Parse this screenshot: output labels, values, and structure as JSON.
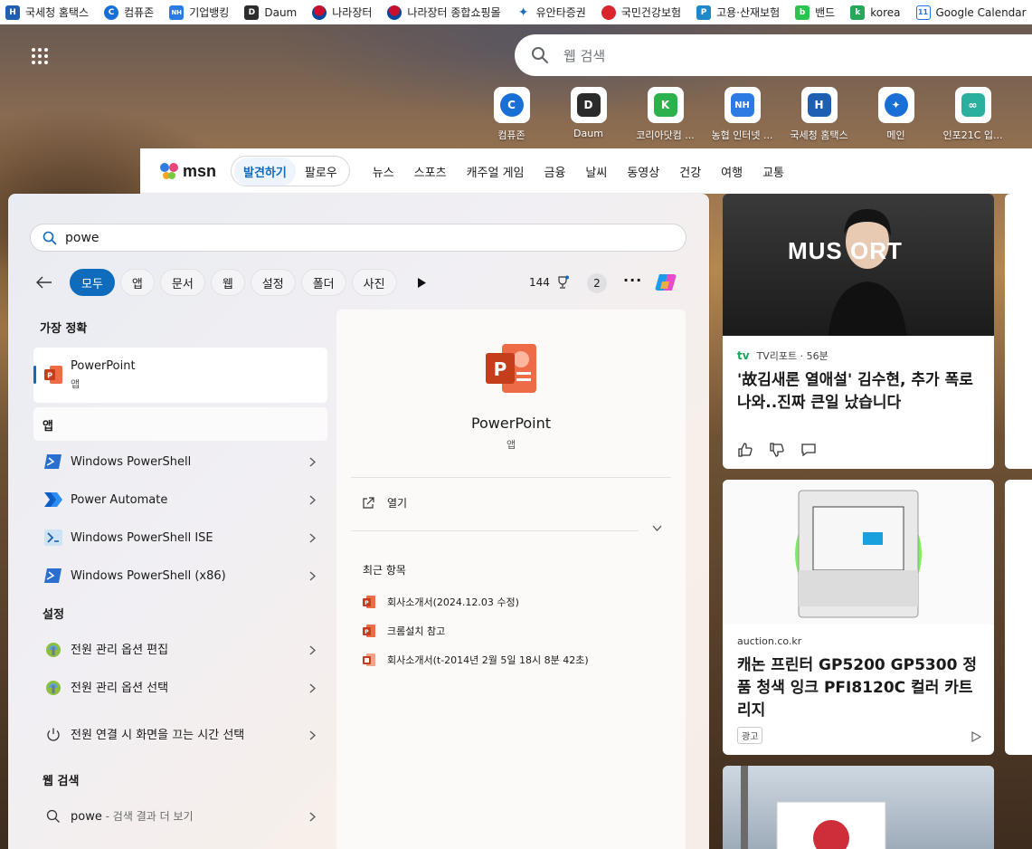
{
  "bookmarks": [
    {
      "label": "국세청 홈택스",
      "color": "#1e5fb4",
      "glyph": "H"
    },
    {
      "label": "컴퓨존",
      "color": "#1a6fd6",
      "glyph": "C"
    },
    {
      "label": "기업뱅킹",
      "color": "#2c7be5",
      "glyph": "NH"
    },
    {
      "label": "Daum",
      "color": "#2b2b2b",
      "glyph": "D"
    },
    {
      "label": "나라장터",
      "color": "#c8102e",
      "glyph": "●"
    },
    {
      "label": "나라장터 종합쇼핑몰",
      "color": "#c8102e",
      "glyph": "●"
    },
    {
      "label": "유안타증권",
      "color": "#1f6fb8",
      "glyph": "✦"
    },
    {
      "label": "국민건강보험",
      "color": "#d9262c",
      "glyph": "●"
    },
    {
      "label": "고용·산재보험",
      "color": "#1e88c9",
      "glyph": "P"
    },
    {
      "label": "밴드",
      "color": "#2bc44d",
      "glyph": "b"
    },
    {
      "label": "korea",
      "color": "#25a85b",
      "glyph": "k"
    },
    {
      "label": "Google Calendar",
      "color": "#1a73e8",
      "glyph": "11"
    }
  ],
  "newtab": {
    "search_placeholder": "웹 검색",
    "tiles": [
      {
        "label": "컴퓨존",
        "color": "#1a6fd6",
        "glyph": "C"
      },
      {
        "label": "Daum",
        "color": "#2b2b2b",
        "glyph": "D"
      },
      {
        "label": "코리아닷컴 ...",
        "color": "#2bb24c",
        "glyph": "K"
      },
      {
        "label": "농협 인터넷 ...",
        "color": "#2c7be5",
        "glyph": "NH"
      },
      {
        "label": "국세청 홈택스",
        "color": "#1e5fb4",
        "glyph": "H"
      },
      {
        "label": "메인",
        "color": "#1a6fd6",
        "glyph": "✦"
      },
      {
        "label": "인포21C 입...",
        "color": "#2bb0a0",
        "glyph": "∞"
      }
    ]
  },
  "msn": {
    "logo": "msn",
    "pill": [
      "발견하기",
      "팔로우"
    ],
    "tabs": [
      "뉴스",
      "스포츠",
      "캐주얼 게임",
      "금융",
      "날씨",
      "동영상",
      "건강",
      "여행",
      "교통"
    ]
  },
  "news": [
    {
      "source": "TV리포트 · 56분",
      "title": "'故김새론 열애설' 김수현, 추가 폭로 나와..진짜 큰일 났습니다",
      "image_text": "MUS  ORT"
    },
    {
      "source": "auction.co.kr",
      "title": "캐논 프린터 GP5200 GP5300 정품 청색 잉크 PFI8120C 컬러 카트리지",
      "badge": "광고"
    }
  ],
  "search": {
    "query": "powe",
    "filters": [
      "모두",
      "앱",
      "문서",
      "웹",
      "설정",
      "폴더",
      "사진"
    ],
    "points": "144",
    "badge_count": "2",
    "more_label": "···",
    "sections": {
      "best_match": "가장 정확",
      "apps": "앱",
      "settings": "설정",
      "web": "웹 검색"
    },
    "best": {
      "name": "PowerPoint",
      "sub": "앱"
    },
    "apps": [
      {
        "name": "Windows PowerShell"
      },
      {
        "name": "Power Automate"
      },
      {
        "name": "Windows PowerShell ISE"
      },
      {
        "name": "Windows PowerShell (x86)"
      }
    ],
    "settings": [
      {
        "name": "전원 관리 옵션 편집"
      },
      {
        "name": "전원 관리 옵션 선택"
      },
      {
        "name": "전원 연결 시 화면을 끄는 시간 선택"
      }
    ],
    "web": {
      "query": "powe",
      "suffix": " - 검색 결과 더 보기"
    },
    "preview": {
      "name": "PowerPoint",
      "sub": "앱",
      "open": "열기",
      "recent_label": "최근 항목",
      "recent": [
        "회사소개서(2024.12.03 수정)",
        "크롬설치 참고",
        "회사소개서(t-2014년 2월 5일 18시 8분 42초)"
      ]
    },
    "accent": "#0f6cbd"
  }
}
